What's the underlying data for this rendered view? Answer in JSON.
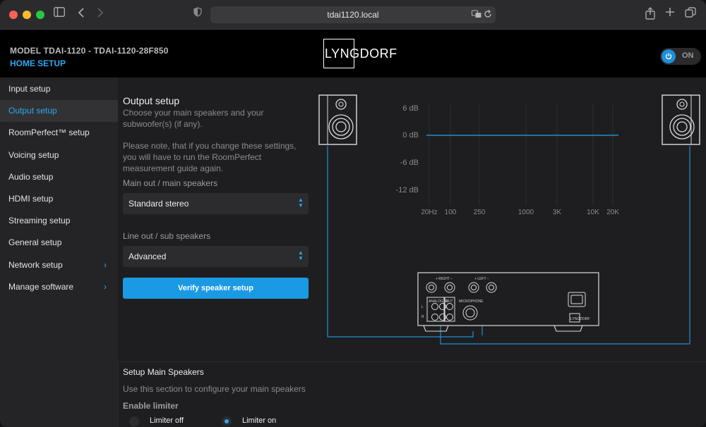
{
  "browser": {
    "url": "tdai1120.local"
  },
  "header": {
    "model": "MODEL TDAI-1120 - TDAI-1120-28F850",
    "nav_home": "HOME",
    "nav_setup": "SETUP",
    "logo": "LYNGDORF",
    "power_label": "ON"
  },
  "sidebar": {
    "items": [
      {
        "label": "Input setup",
        "active": false,
        "submenu": false
      },
      {
        "label": "Output setup",
        "active": true,
        "submenu": false
      },
      {
        "label": "RoomPerfect™ setup",
        "active": false,
        "submenu": false
      },
      {
        "label": "Voicing setup",
        "active": false,
        "submenu": false
      },
      {
        "label": "Audio setup",
        "active": false,
        "submenu": false
      },
      {
        "label": "HDMI setup",
        "active": false,
        "submenu": false
      },
      {
        "label": "Streaming setup",
        "active": false,
        "submenu": false
      },
      {
        "label": "General setup",
        "active": false,
        "submenu": false
      },
      {
        "label": "Network setup",
        "active": false,
        "submenu": true
      },
      {
        "label": "Manage software",
        "active": false,
        "submenu": true
      }
    ]
  },
  "output": {
    "title": "Output setup",
    "intro": "Choose your main speakers and your subwoofer(s) (if any).",
    "note": "Please note, that if you change these settings, you will have to run the RoomPerfect measurement guide again.",
    "main_label": "Main out / main speakers",
    "main_value": "Standard stereo",
    "sub_label": "Line out / sub speakers",
    "sub_value": "Advanced",
    "verify_button": "Verify speaker setup"
  },
  "graph": {
    "db_labels": [
      "6 dB",
      "0 dB",
      "-6 dB",
      "-12 dB"
    ],
    "freq_labels": [
      "20Hz",
      "100",
      "250",
      "1000",
      "3K",
      "10K",
      "20K"
    ]
  },
  "amp_panel": {
    "right": "+ RIGHT −",
    "left": "+ LEFT −",
    "analog_in": "ANALOG IN",
    "out": "OUT",
    "microphone": "MICROPHONE",
    "l": "L",
    "r": "R",
    "brand": "LYNGDORF"
  },
  "speakers": {
    "title": "Setup Main Speakers",
    "desc": "Use this section to configure your main speakers",
    "limiter_title": "Enable limiter",
    "limiter_off": "Limiter off",
    "limiter_on": "Limiter on",
    "limiter_selected": "on"
  },
  "colors": {
    "accent": "#2aa8f0",
    "button": "#1b9ae4",
    "background": "#1e1e20",
    "sidebar": "#242426",
    "header": "#000000"
  }
}
